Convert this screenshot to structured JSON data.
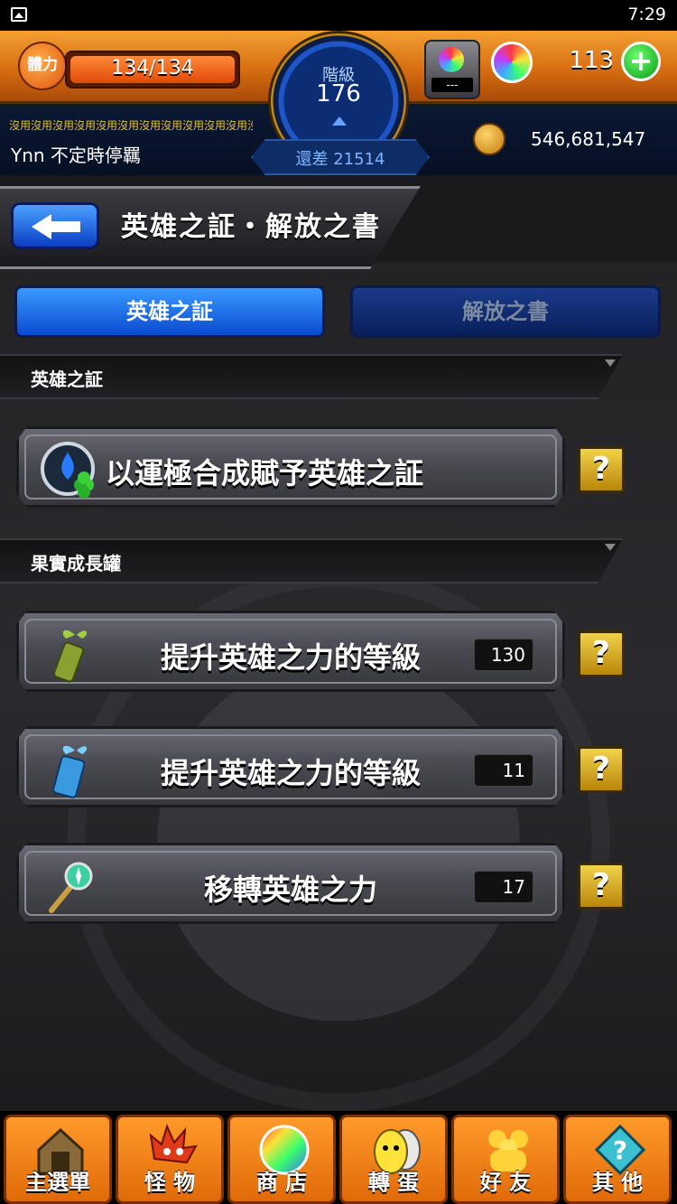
{
  "status_bar": {
    "time": "7:29"
  },
  "header": {
    "stamina_label": "體力",
    "stamina": "134/134",
    "stamina_fraction": 1.0,
    "rank_label": "階級",
    "rank_value": "176",
    "remaining": "還差 21514",
    "gacha_indicator": "---",
    "orb_count": "113",
    "marquee": "沒用沒用沒用沒用沒用沒用沒用沒用沒用沒用沒用沒用沒用沒用沒用沒用沒用沒用沒用沒用沒用沒用沒用",
    "player_name": "Ynn 不定時停羈",
    "coin_count": "546,681,547"
  },
  "title": "英雄之証・解放之書",
  "tabs": [
    {
      "label": "英雄之証",
      "active": true
    },
    {
      "label": "解放之書",
      "active": false
    }
  ],
  "sections": [
    {
      "label": "英雄之証",
      "items": [
        {
          "label": "以運極合成賦予英雄之証",
          "count": null,
          "icon": "hero-proof-clover-icon"
        }
      ]
    },
    {
      "label": "果實成長罐",
      "items": [
        {
          "label": "提升英雄之力的等級",
          "count": "130",
          "icon": "growth-bottle-green-icon"
        },
        {
          "label": "提升英雄之力的等級",
          "count": "11",
          "icon": "growth-bottle-blue-icon"
        },
        {
          "label": "移轉英雄之力",
          "count": "17",
          "icon": "transfer-wand-icon"
        }
      ]
    }
  ],
  "help_label": "?",
  "bottom_nav": [
    {
      "label": "主選單",
      "icon": "house-icon"
    },
    {
      "label": "怪 物",
      "icon": "monster-icon"
    },
    {
      "label": "商 店",
      "icon": "orb-shop-icon"
    },
    {
      "label": "轉 蛋",
      "icon": "egg-icon"
    },
    {
      "label": "好 友",
      "icon": "friends-icon"
    },
    {
      "label": "其 他",
      "icon": "other-icon"
    }
  ],
  "colors": {
    "accent_orange": "#e06a08",
    "tab_active": "#2a7aff",
    "help_gold": "#d4a82a"
  }
}
